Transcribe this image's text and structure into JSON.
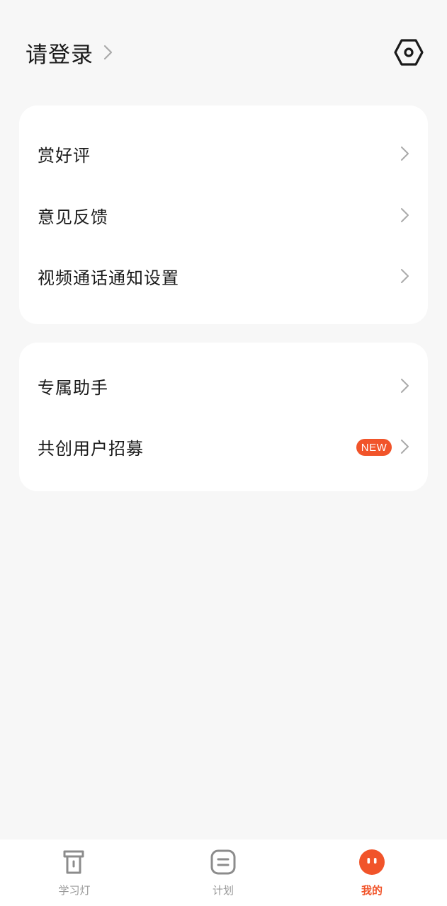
{
  "header": {
    "login_label": "请登录",
    "settings_icon": "hexagon-settings-icon"
  },
  "card1": {
    "items": [
      {
        "label": "赏好评"
      },
      {
        "label": "意见反馈"
      },
      {
        "label": "视频通话通知设置"
      }
    ]
  },
  "card2": {
    "items": [
      {
        "label": "专属助手"
      },
      {
        "label": "共创用户招募",
        "badge": "NEW"
      }
    ]
  },
  "tabbar": {
    "tabs": [
      {
        "label": "学习灯",
        "icon": "lamp-icon",
        "active": false
      },
      {
        "label": "计划",
        "icon": "plan-icon",
        "active": false
      },
      {
        "label": "我的",
        "icon": "profile-face-icon",
        "active": true
      }
    ]
  },
  "colors": {
    "accent": "#f1542a",
    "background": "#f7f7f7",
    "card": "#ffffff",
    "text": "#1a1a1a",
    "muted": "#999999"
  }
}
